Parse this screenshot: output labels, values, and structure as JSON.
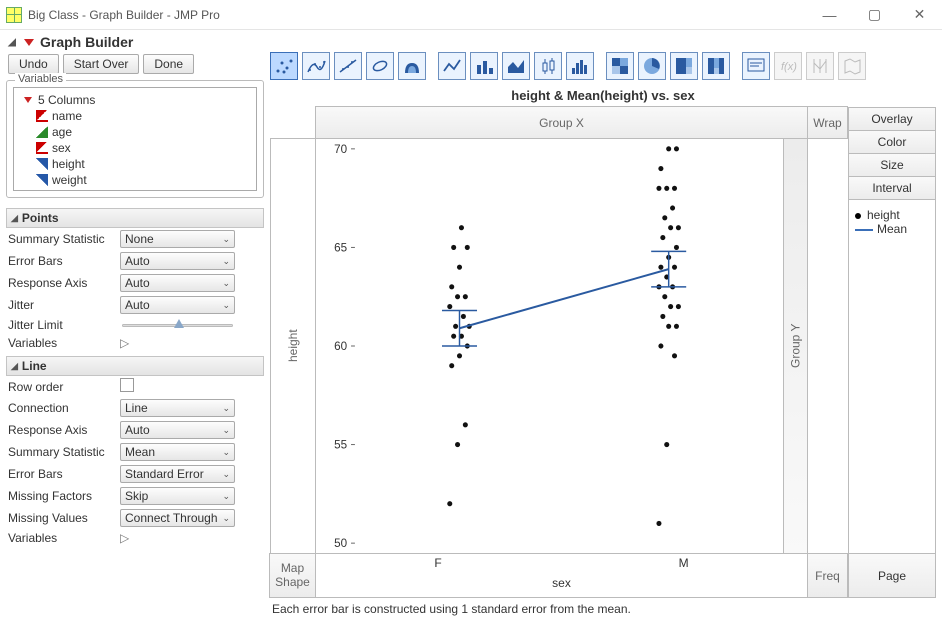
{
  "window": {
    "title": "Big Class - Graph Builder - JMP Pro"
  },
  "header": {
    "section_title": "Graph Builder"
  },
  "toolbar": {
    "undo": "Undo",
    "start_over": "Start Over",
    "done": "Done"
  },
  "variables": {
    "fieldset_label": "Variables",
    "header": "5 Columns",
    "items": [
      {
        "label": "name",
        "type": "nominal"
      },
      {
        "label": "age",
        "type": "ordinal"
      },
      {
        "label": "sex",
        "type": "nominal"
      },
      {
        "label": "height",
        "type": "continuous"
      },
      {
        "label": "weight",
        "type": "continuous"
      }
    ]
  },
  "panels": {
    "points": {
      "title": "Points",
      "summary_stat_label": "Summary Statistic",
      "summary_stat_value": "None",
      "error_bars_label": "Error Bars",
      "error_bars_value": "Auto",
      "response_axis_label": "Response Axis",
      "response_axis_value": "Auto",
      "jitter_label": "Jitter",
      "jitter_value": "Auto",
      "jitter_limit_label": "Jitter Limit",
      "variables_label": "Variables"
    },
    "line": {
      "title": "Line",
      "row_order_label": "Row order",
      "connection_label": "Connection",
      "connection_value": "Line",
      "response_axis_label": "Response Axis",
      "response_axis_value": "Auto",
      "summary_stat_label": "Summary Statistic",
      "summary_stat_value": "Mean",
      "error_bars_label": "Error Bars",
      "error_bars_value": "Standard Error",
      "missing_factors_label": "Missing Factors",
      "missing_factors_value": "Skip",
      "missing_values_label": "Missing Values",
      "missing_values_value": "Connect Through",
      "variables_label": "Variables"
    }
  },
  "chart_palette": [
    "points",
    "points-jitter",
    "points-density",
    "contour",
    "contour-fill",
    "line",
    "bars",
    "area",
    "box",
    "violin",
    "histogram",
    "heatmap",
    "pie",
    "treemap",
    "mosaic",
    "table",
    "fx",
    "parallel",
    "map"
  ],
  "graph": {
    "title": "height & Mean(height) vs. sex",
    "zones": {
      "group_x": "Group X",
      "wrap": "Wrap",
      "overlay": "Overlay",
      "color": "Color",
      "size": "Size",
      "interval": "Interval",
      "group_y": "Group Y",
      "map_shape": "Map\nShape",
      "freq": "Freq",
      "page": "Page",
      "ylabel": "height",
      "xlabel": "sex"
    },
    "legend": {
      "series1": "height",
      "series2": "Mean"
    },
    "footnote": "Each error bar is constructed using 1 standard error from the mean."
  },
  "chart_data": {
    "type": "scatter",
    "title": "height & Mean(height) vs. sex",
    "xlabel": "sex",
    "ylabel": "height",
    "categories": [
      "F",
      "M"
    ],
    "ylim": [
      50,
      70
    ],
    "yticks": [
      50,
      55,
      60,
      65,
      70
    ],
    "series": [
      {
        "name": "height",
        "type": "points",
        "data": {
          "F": [
            52,
            55,
            56,
            59,
            59.5,
            60,
            60.5,
            60.5,
            61,
            61,
            61.5,
            62,
            62.5,
            62.5,
            63,
            64,
            65,
            65,
            66
          ],
          "M": [
            51,
            55,
            59.5,
            60,
            61,
            61,
            61.5,
            62,
            62,
            62.5,
            63,
            63,
            63.5,
            64,
            64,
            64.5,
            65,
            65.5,
            66,
            66,
            66.5,
            67,
            68,
            68,
            68,
            69,
            70,
            70
          ]
        }
      },
      {
        "name": "Mean",
        "type": "line_with_error",
        "means": {
          "F": 60.9,
          "M": 63.9
        },
        "stderr": {
          "F": 0.9,
          "M": 0.9
        }
      }
    ]
  }
}
